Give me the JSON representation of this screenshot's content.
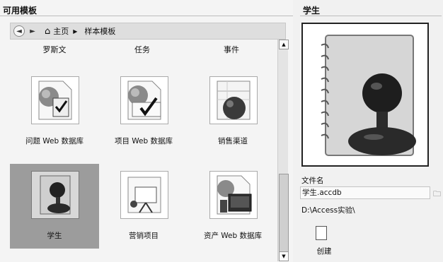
{
  "left": {
    "section_title": "可用模板"
  },
  "nav": {
    "back_icon": "back-arrow-icon",
    "home": "主页",
    "crumb": "样本模板"
  },
  "top_labels": [
    "罗斯文",
    "任务",
    "事件"
  ],
  "tiles": [
    {
      "label": "问题 Web 数据库"
    },
    {
      "label": "项目 Web 数据库"
    },
    {
      "label": "销售渠道"
    },
    {
      "label": "学生"
    },
    {
      "label": "营销项目"
    },
    {
      "label": "资产 Web 数据库"
    }
  ],
  "right": {
    "title": "学生",
    "file_name_label": "文件名",
    "file_name": "学生.accdb",
    "path": "D:\\Access实验\\",
    "create_label": "创建"
  }
}
